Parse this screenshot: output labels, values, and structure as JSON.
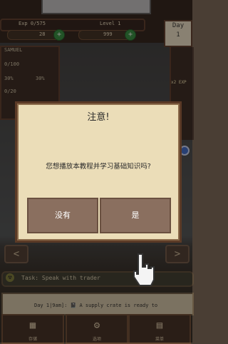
{
  "hud": {
    "exp": "Exp 0/575",
    "level": "Level 1",
    "coins": "28",
    "gems": "999",
    "day_label": "Day",
    "day_number": "1",
    "player_name": "SAMUEL",
    "hp": "0/100",
    "food": "30%",
    "water": "30%",
    "misc": "0/20",
    "exp_multiplier": "x2 EXP"
  },
  "dialog": {
    "title": "注意!",
    "message": "您想播放本教程并学习基础知识吗?",
    "no_button": "没有",
    "yes_button": "是"
  },
  "nav": {
    "left": "<",
    "right": ">"
  },
  "task": {
    "text": "Task: Speak with trader"
  },
  "log": {
    "text": "Day 1|9am]: 📓 A supply crate is ready to"
  },
  "tabs": [
    {
      "label": "存储"
    },
    {
      "label": "选项"
    },
    {
      "label": "菜单"
    }
  ]
}
